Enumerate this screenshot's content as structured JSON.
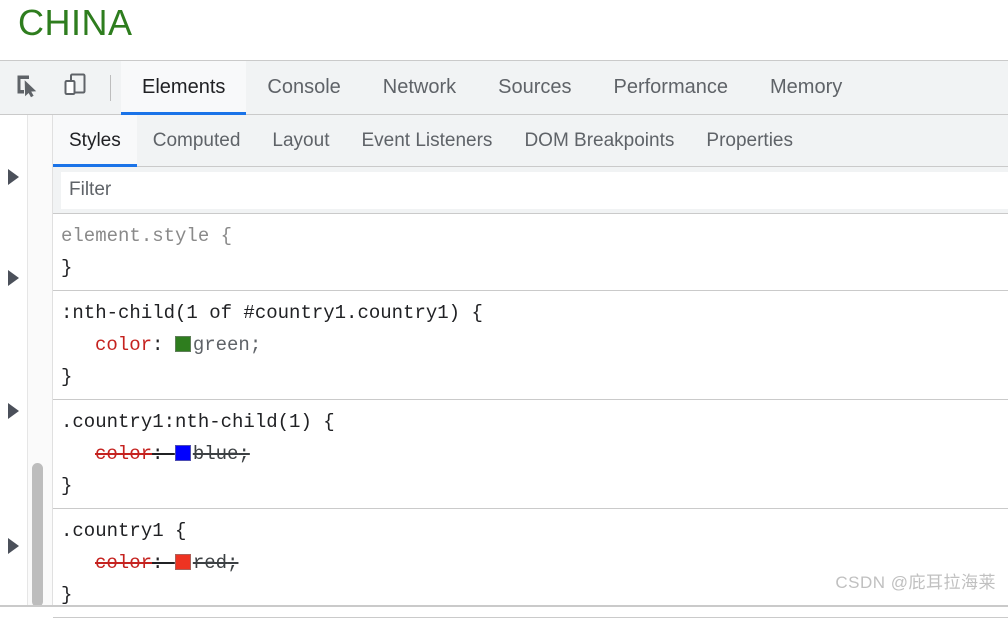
{
  "page": {
    "heading": "CHINA",
    "heading_color": "#2e7d1e"
  },
  "devtools": {
    "toolbar": {
      "inspect_icon": "inspect-cursor-icon",
      "device_icon": "device-toolbar-icon",
      "tabs": [
        {
          "label": "Elements",
          "active": true
        },
        {
          "label": "Console",
          "active": false
        },
        {
          "label": "Network",
          "active": false
        },
        {
          "label": "Sources",
          "active": false
        },
        {
          "label": "Performance",
          "active": false
        },
        {
          "label": "Memory",
          "active": false
        }
      ]
    },
    "sidebar_tabs": [
      {
        "label": "Styles",
        "active": true
      },
      {
        "label": "Computed",
        "active": false
      },
      {
        "label": "Layout",
        "active": false
      },
      {
        "label": "Event Listeners",
        "active": false
      },
      {
        "label": "DOM Breakpoints",
        "active": false
      },
      {
        "label": "Properties",
        "active": false
      }
    ],
    "filter": {
      "placeholder": "Filter",
      "value": ""
    },
    "accent_color": "#1a73e8",
    "rules": [
      {
        "selector": "element.style {",
        "close": "}",
        "is_inline_style": true,
        "declarations": []
      },
      {
        "selector": ":nth-child(1 of #country1.country1) {",
        "close": "}",
        "is_inline_style": false,
        "declarations": [
          {
            "property": "color",
            "value": "green",
            "swatch_color": "#2e7d1e",
            "overridden": false
          }
        ]
      },
      {
        "selector": ".country1:nth-child(1) {",
        "close": "}",
        "is_inline_style": false,
        "declarations": [
          {
            "property": "color",
            "value": "blue",
            "swatch_color": "#0000ff",
            "overridden": true
          }
        ]
      },
      {
        "selector": ".country1 {",
        "close": "}",
        "is_inline_style": false,
        "declarations": [
          {
            "property": "color",
            "value": "red",
            "swatch_color": "#ee3322",
            "overridden": true
          }
        ]
      }
    ]
  },
  "watermark": "CSDN @庇耳拉海莱"
}
